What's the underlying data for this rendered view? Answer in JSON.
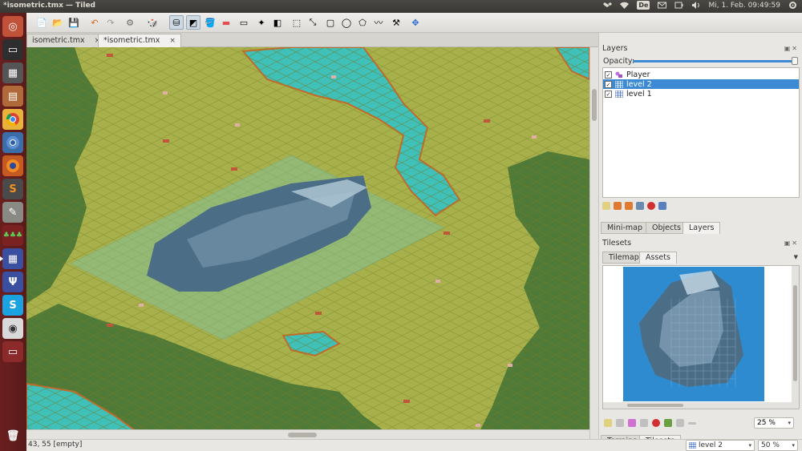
{
  "system": {
    "window_title": "*isometric.tmx — Tiled",
    "keyboard_layout": "De",
    "clock": "Mi, 1. Feb. 09:49:59"
  },
  "launcher": {
    "items": [
      "ubuntu-dash",
      "terminal",
      "calculator",
      "files",
      "chrome",
      "chromium",
      "firefox",
      "sublime-text",
      "text-editor",
      "game",
      "tiled",
      "vs",
      "skype",
      "webcam",
      "app",
      "trash"
    ]
  },
  "tabs": [
    {
      "label": "isometric.tmx",
      "close": "×"
    },
    {
      "label": "*isometric.tmx",
      "close": "×"
    }
  ],
  "status": {
    "coords": "43, 55 [empty]",
    "layer_select": "level 2",
    "zoom_select": "50 %"
  },
  "layers_panel": {
    "title": "Layers",
    "opacity_label": "Opacity:",
    "opacity_value": 1.0,
    "layers": [
      {
        "name": "Player",
        "type": "object",
        "visible": true,
        "selected": false
      },
      {
        "name": "level 2",
        "type": "tile",
        "visible": true,
        "selected": true
      },
      {
        "name": "level 1",
        "type": "tile",
        "visible": true,
        "selected": false
      }
    ],
    "tabs": [
      "Mini-map",
      "Objects",
      "Layers"
    ],
    "active_tab": "Layers"
  },
  "tilesets_panel": {
    "title": "Tilesets",
    "tabs": [
      "Tilemap",
      "Assets"
    ],
    "active_tab": "Assets",
    "zoom": "25 %",
    "bottom_tabs": [
      "Terrains",
      "Tilesets"
    ],
    "active_bottom_tab": "Tilesets"
  },
  "colors": {
    "accent": "#3c8ad3",
    "launcher": "#5e1c1c",
    "grass": "#a7b04a",
    "forest": "#4f7a37",
    "water": "#3fc0b8",
    "tileset_bg": "#2e8bd0"
  }
}
